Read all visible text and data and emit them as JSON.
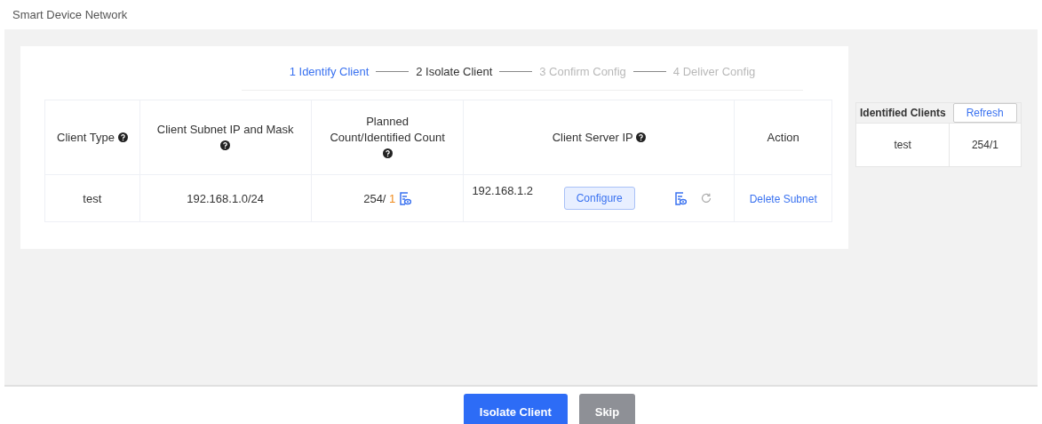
{
  "page_title": "Smart Device Network",
  "steps": [
    {
      "number": "1",
      "label": "Identify Client",
      "selected": true,
      "disabled": false
    },
    {
      "number": "2",
      "label": "Isolate Client",
      "selected": false,
      "disabled": false
    },
    {
      "number": "3",
      "label": "Confirm Config",
      "selected": false,
      "disabled": true
    },
    {
      "number": "4",
      "label": "Deliver Config",
      "selected": false,
      "disabled": true
    }
  ],
  "table": {
    "columns": [
      {
        "label": "Client Type",
        "help": true
      },
      {
        "label": "Client Subnet IP and Mask",
        "help": true
      },
      {
        "label": "Planned Count/Identified Count",
        "help": true
      },
      {
        "label": "Client Server IP",
        "help": true
      },
      {
        "label": "Action",
        "help": false
      }
    ],
    "rows": [
      {
        "client_type": "test",
        "subnet": "192.168.1.0/24",
        "planned": "254/",
        "identified": "1",
        "server_ip": "192.168.1.2",
        "configure": "Configure",
        "action": "Delete Subnet"
      }
    ]
  },
  "identified_clients": {
    "title": "Identified Clients",
    "refresh": "Refresh",
    "rows": [
      {
        "type": "test",
        "count": "254/1"
      }
    ]
  },
  "buttons": [
    {
      "label": "Isolate Client",
      "kind": "primary"
    },
    {
      "label": "Skip",
      "kind": "secondary"
    }
  ]
}
